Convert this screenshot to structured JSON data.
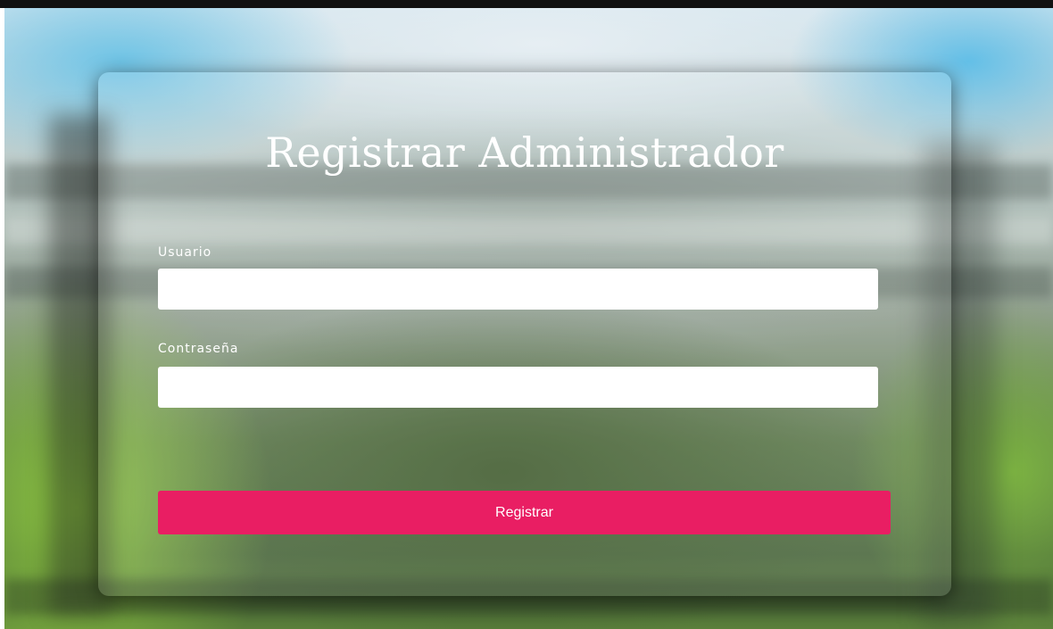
{
  "form": {
    "title": "Registrar Administrador",
    "username_label": "Usuario",
    "username_value": "",
    "password_label": "Contraseña",
    "password_value": "",
    "submit_label": "Registrar"
  },
  "colors": {
    "accent": "#e91e63",
    "text_on_glass": "#ffffff",
    "top_bar": "#111111"
  }
}
